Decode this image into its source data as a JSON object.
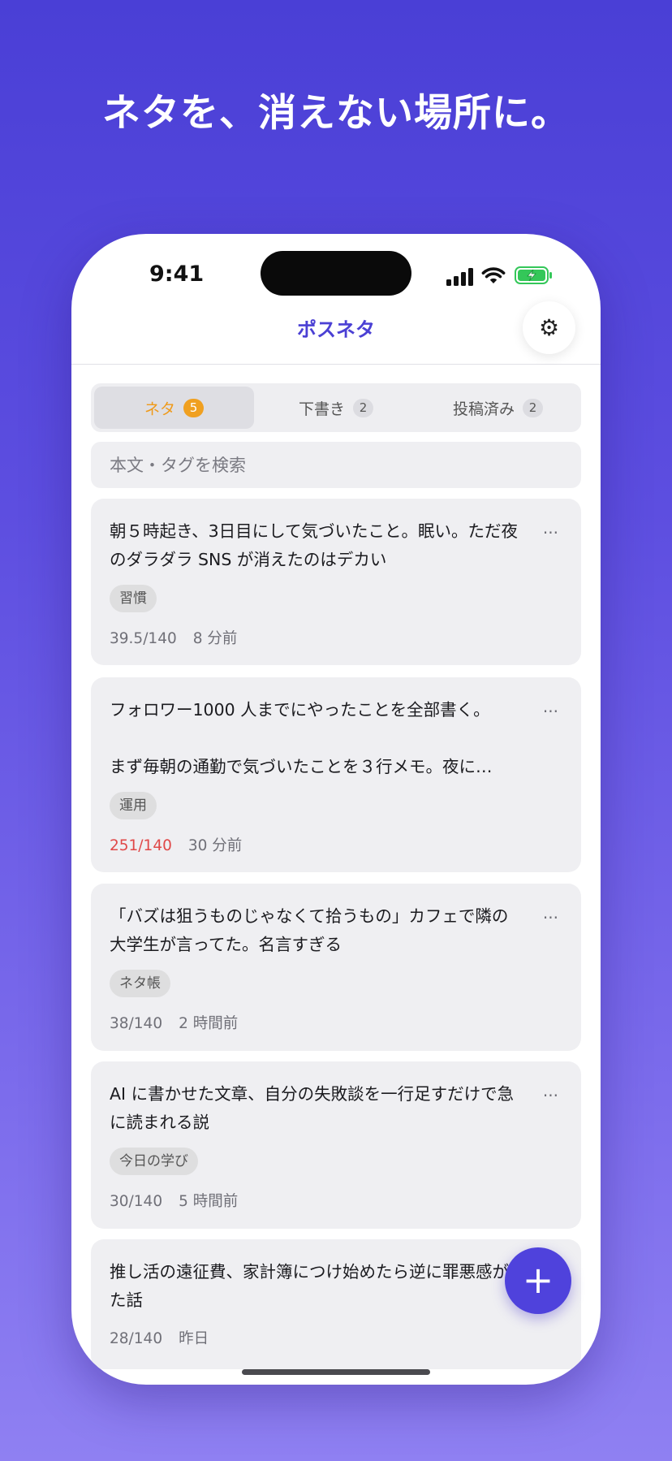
{
  "headline": "ネタを、消えない場所に。",
  "status_bar": {
    "time": "9:41"
  },
  "navbar": {
    "title": "ポスネタ",
    "settings_icon": "gear-icon"
  },
  "tabs": [
    {
      "label": "ネタ",
      "count": "5",
      "active": true
    },
    {
      "label": "下書き",
      "count": "2",
      "active": false
    },
    {
      "label": "投稿済み",
      "count": "2",
      "active": false
    }
  ],
  "search": {
    "placeholder": "本文・タグを検索",
    "value": ""
  },
  "cards": [
    {
      "text": "朝５時起き、3日目にして気づいたこと。眠い。ただ夜のダラダラ SNS が消えたのはデカい",
      "tag": "習慣",
      "count": "39.5/140",
      "over": false,
      "time": "8 分前"
    },
    {
      "text": "フォロワー1000 人までにやったことを全部書く。\n\nまず毎朝の通勤で気づいたことを３行メモ。夜に…",
      "tag": "運用",
      "count": "251/140",
      "over": true,
      "time": "30 分前"
    },
    {
      "text": "「バズは狙うものじゃなくて拾うもの」カフェで隣の大学生が言ってた。名言すぎる",
      "tag": "ネタ帳",
      "count": "38/140",
      "over": false,
      "time": "2 時間前"
    },
    {
      "text": "AI に書かせた文章、自分の失敗談を一行足すだけで急に読まれる説",
      "tag": "今日の学び",
      "count": "30/140",
      "over": false,
      "time": "5 時間前"
    },
    {
      "text": "推し活の遠征費、家計簿につけ始めたら逆に罪悪感が消えた話",
      "tag": "",
      "count": "28/140",
      "over": false,
      "time": "昨日"
    }
  ],
  "card_menu_label": "···",
  "fab": {
    "label": "+"
  },
  "colors": {
    "accent": "#4b40d4",
    "active_tab": "#ef9a1a",
    "over_limit": "#e04848"
  }
}
